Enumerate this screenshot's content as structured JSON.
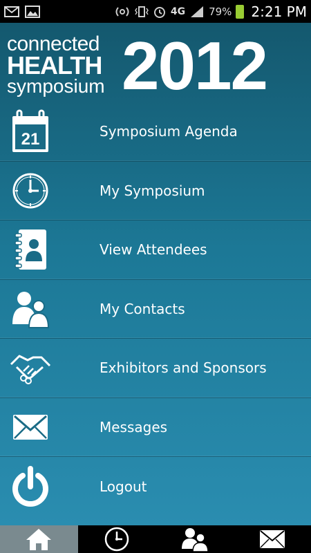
{
  "status_bar": {
    "icons_left": [
      "gmail-icon",
      "gallery-icon"
    ],
    "network": "4G",
    "battery": "79%",
    "time": "2:21 PM"
  },
  "header": {
    "logo_line1": "connected",
    "logo_line2": "HEALTH",
    "logo_line3": "symposium",
    "year": "2012"
  },
  "menu": {
    "items": [
      {
        "label": "Symposium Agenda",
        "icon": "calendar-icon",
        "calendar_day": "21"
      },
      {
        "label": "My Symposium",
        "icon": "clock-icon"
      },
      {
        "label": "View Attendees",
        "icon": "address-book-icon"
      },
      {
        "label": "My Contacts",
        "icon": "people-icon"
      },
      {
        "label": "Exhibitors and Sponsors",
        "icon": "handshake-icon"
      },
      {
        "label": "Messages",
        "icon": "envelope-icon"
      },
      {
        "label": "Logout",
        "icon": "power-icon"
      }
    ]
  },
  "bottom_tabs": [
    {
      "icon": "home-icon",
      "active": true
    },
    {
      "icon": "clock-icon",
      "active": false
    },
    {
      "icon": "people-icon",
      "active": false
    },
    {
      "icon": "envelope-icon",
      "active": false
    }
  ],
  "colors": {
    "gradient_top": "#14586e",
    "gradient_bottom": "#2a8db0",
    "active_tab": "#7a8a8f"
  }
}
